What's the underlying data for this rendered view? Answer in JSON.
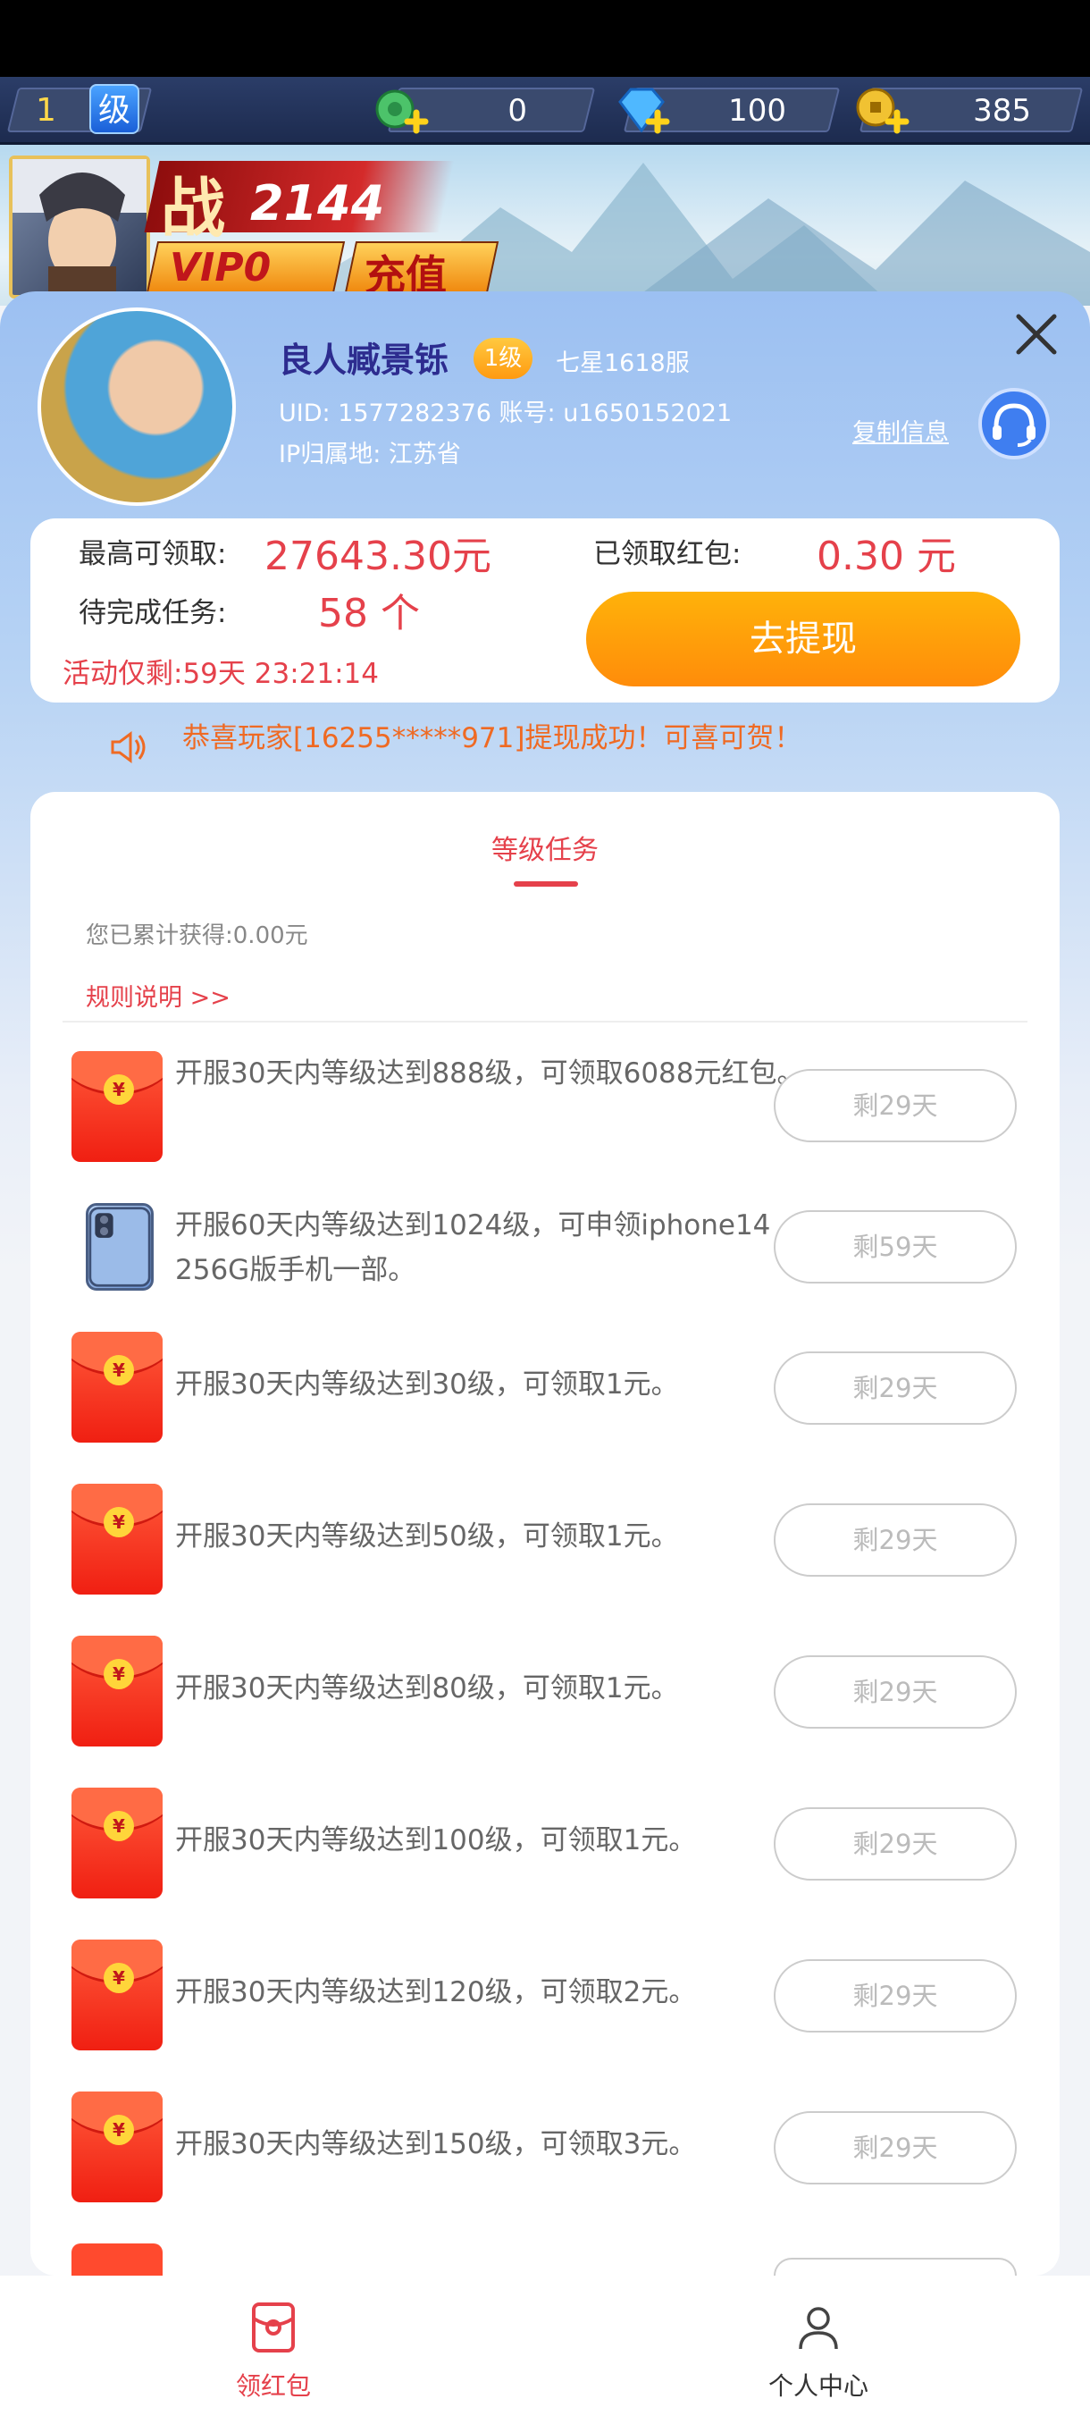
{
  "hud": {
    "level": "1",
    "level_badge": "级",
    "jade": "0",
    "diamond": "100",
    "gold": "385"
  },
  "banner": {
    "power_label": "战",
    "power_value": "2144",
    "vip": "VIP0",
    "recharge": "充值"
  },
  "profile": {
    "name": "良人臧景铄",
    "level": "1级",
    "server": "七星1618服",
    "uid_line": "UID: 1577282376 账号: u1650152021",
    "ip_line": "IP归属地: 江苏省",
    "copy_label": "复制信息"
  },
  "summary": {
    "max_label": "最高可领取:",
    "max_value": "27643.30元",
    "received_label": "已领取红包:",
    "received_value": "0.30 元",
    "pending_label": "待完成任务:",
    "pending_value": "58 个",
    "timer": "活动仅剩:59天 23:21:14",
    "withdraw_label": "去提现"
  },
  "notice": "恭喜玩家[16255*****971]提现成功！可喜可贺！",
  "tasks_card": {
    "tab": "等级任务",
    "earned": "您已累计获得:0.00元",
    "rules": "规则说明 >>",
    "items": [
      {
        "desc": "开服30天内等级达到888级，可领取6088元红包。",
        "button": "剩29天"
      },
      {
        "desc": "开服60天内等级达到1024级，可申领iphone14 256G版手机一部。",
        "button": "剩59天"
      },
      {
        "desc": "开服30天内等级达到30级，可领取1元。",
        "button": "剩29天"
      },
      {
        "desc": "开服30天内等级达到50级，可领取1元。",
        "button": "剩29天"
      },
      {
        "desc": "开服30天内等级达到80级，可领取1元。",
        "button": "剩29天"
      },
      {
        "desc": "开服30天内等级达到100级，可领取1元。",
        "button": "剩29天"
      },
      {
        "desc": "开服30天内等级达到120级，可领取2元。",
        "button": "剩29天"
      },
      {
        "desc": "开服30天内等级达到150级，可领取3元。",
        "button": "剩29天"
      }
    ]
  },
  "nav": {
    "redpacket": "领红包",
    "profile": "个人中心"
  },
  "colors": {
    "accent": "#e5414b",
    "orange": "#ff9a0a"
  }
}
